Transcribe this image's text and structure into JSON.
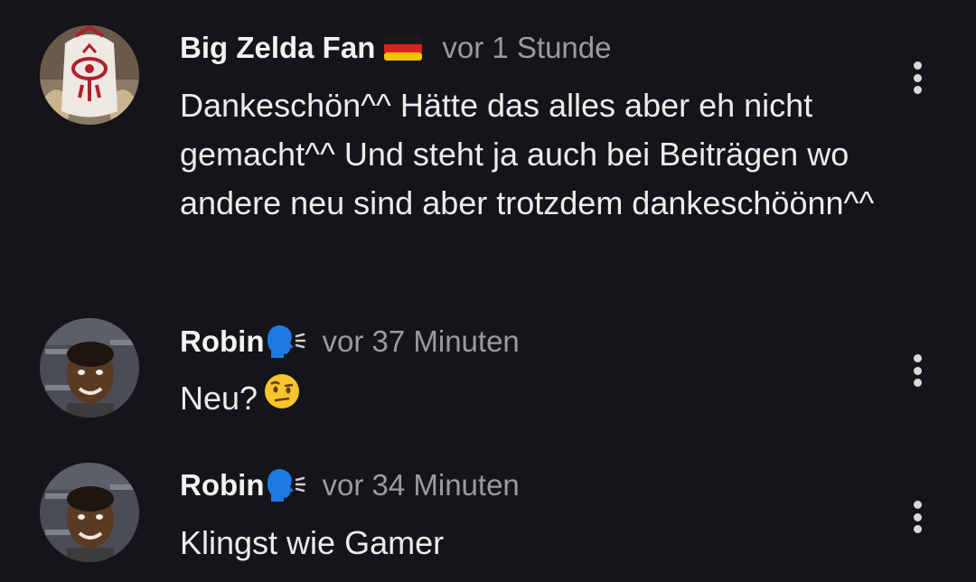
{
  "comments": [
    {
      "author": "Big Zelda Fan",
      "badge_icon": "german-flag-icon",
      "time": "vor 1 Stunde",
      "text": "Dankeschön^^ Hätte das alles aber eh nicht gemacht^^ Und steht ja auch bei Beiträgen wo andere neu sind aber trotzdem dankeschöönn^^",
      "avatar_icon": "sheikah-eye-avatar",
      "menu_icon": "more-vert-icon"
    },
    {
      "author": "Robin",
      "badge_icon": "speaking-head-icon",
      "time": "vor 37 Minuten",
      "text": "Neu?",
      "trailing_emoji_icon": "raised-eyebrow-face-icon",
      "avatar_icon": "person-photo-avatar",
      "menu_icon": "more-vert-icon"
    },
    {
      "author": "Robin",
      "badge_icon": "speaking-head-icon",
      "time": "vor 34 Minuten",
      "text": "Klingst wie Gamer",
      "avatar_icon": "person-photo-avatar",
      "menu_icon": "more-vert-icon"
    }
  ],
  "colors": {
    "background": "#141419",
    "text": "#ececec",
    "timestamp": "#9a9aa0",
    "badge_blue": "#1e7ae0"
  }
}
